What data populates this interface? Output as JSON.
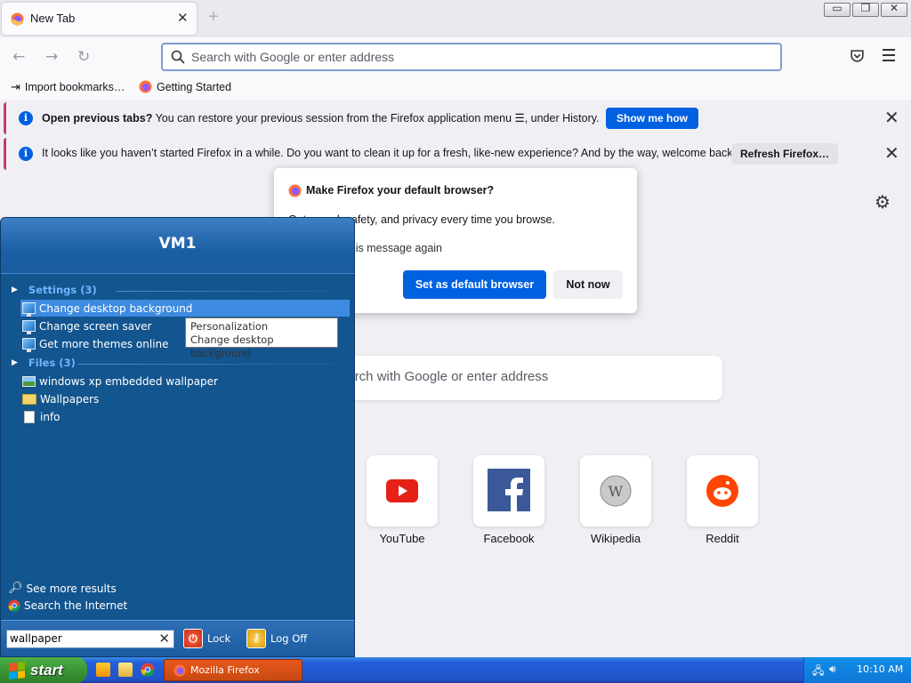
{
  "browser": {
    "tab_title": "New Tab",
    "tab_close_glyph": "✕",
    "new_tab_glyph": "+",
    "url_placeholder": "Search with Google or enter address",
    "bookmarks": [
      "Import bookmarks…",
      "Getting Started"
    ]
  },
  "window_controls": {
    "minimize": "▭",
    "restore": "❐",
    "close": "✕"
  },
  "notifications": [
    {
      "bold": "Open previous tabs?",
      "text": " You can restore your previous session from the Firefox application menu ☰, under History.",
      "button": "Show me how",
      "close": "✕"
    },
    {
      "text": "It looks like you haven’t started Firefox in a while. Do you want to clean it up for a fresh, like-new experience? And by the way, welcome back!",
      "button": "Refresh Firefox…",
      "close": "✕"
    }
  ],
  "dialog": {
    "title": "Make Firefox your default browser?",
    "subtitle": "Get speed, safety, and privacy every time you browse.",
    "checkbox": "Don’t show this message again",
    "primary": "Set as default browser",
    "secondary": "Not now"
  },
  "newtab": {
    "search_placeholder": "Search with Google or enter address",
    "sites": [
      "YouTube",
      "Facebook",
      "Wikipedia",
      "Reddit"
    ]
  },
  "startmenu": {
    "title": "VM1",
    "settings_header": "Settings (3)",
    "settings_items": [
      "Change desktop background",
      "Change screen saver",
      "Get more themes online"
    ],
    "tooltip": {
      "line1": "Personalization",
      "line2": "Change desktop background"
    },
    "files_header": "Files (3)",
    "file_items": [
      "windows xp embedded wallpaper",
      "Wallpapers",
      "info"
    ],
    "see_more": "See more results",
    "search_internet": "Search the Internet",
    "search_value": "wallpaper",
    "lock": "Lock",
    "logoff": "Log Off"
  },
  "taskbar": {
    "start": "start",
    "task": "Mozilla Firefox",
    "clock": "10:10 AM"
  },
  "colors": {
    "accent": "#0061e0",
    "startmenu_bg": "#13558e",
    "taskbar": "#245edb"
  }
}
